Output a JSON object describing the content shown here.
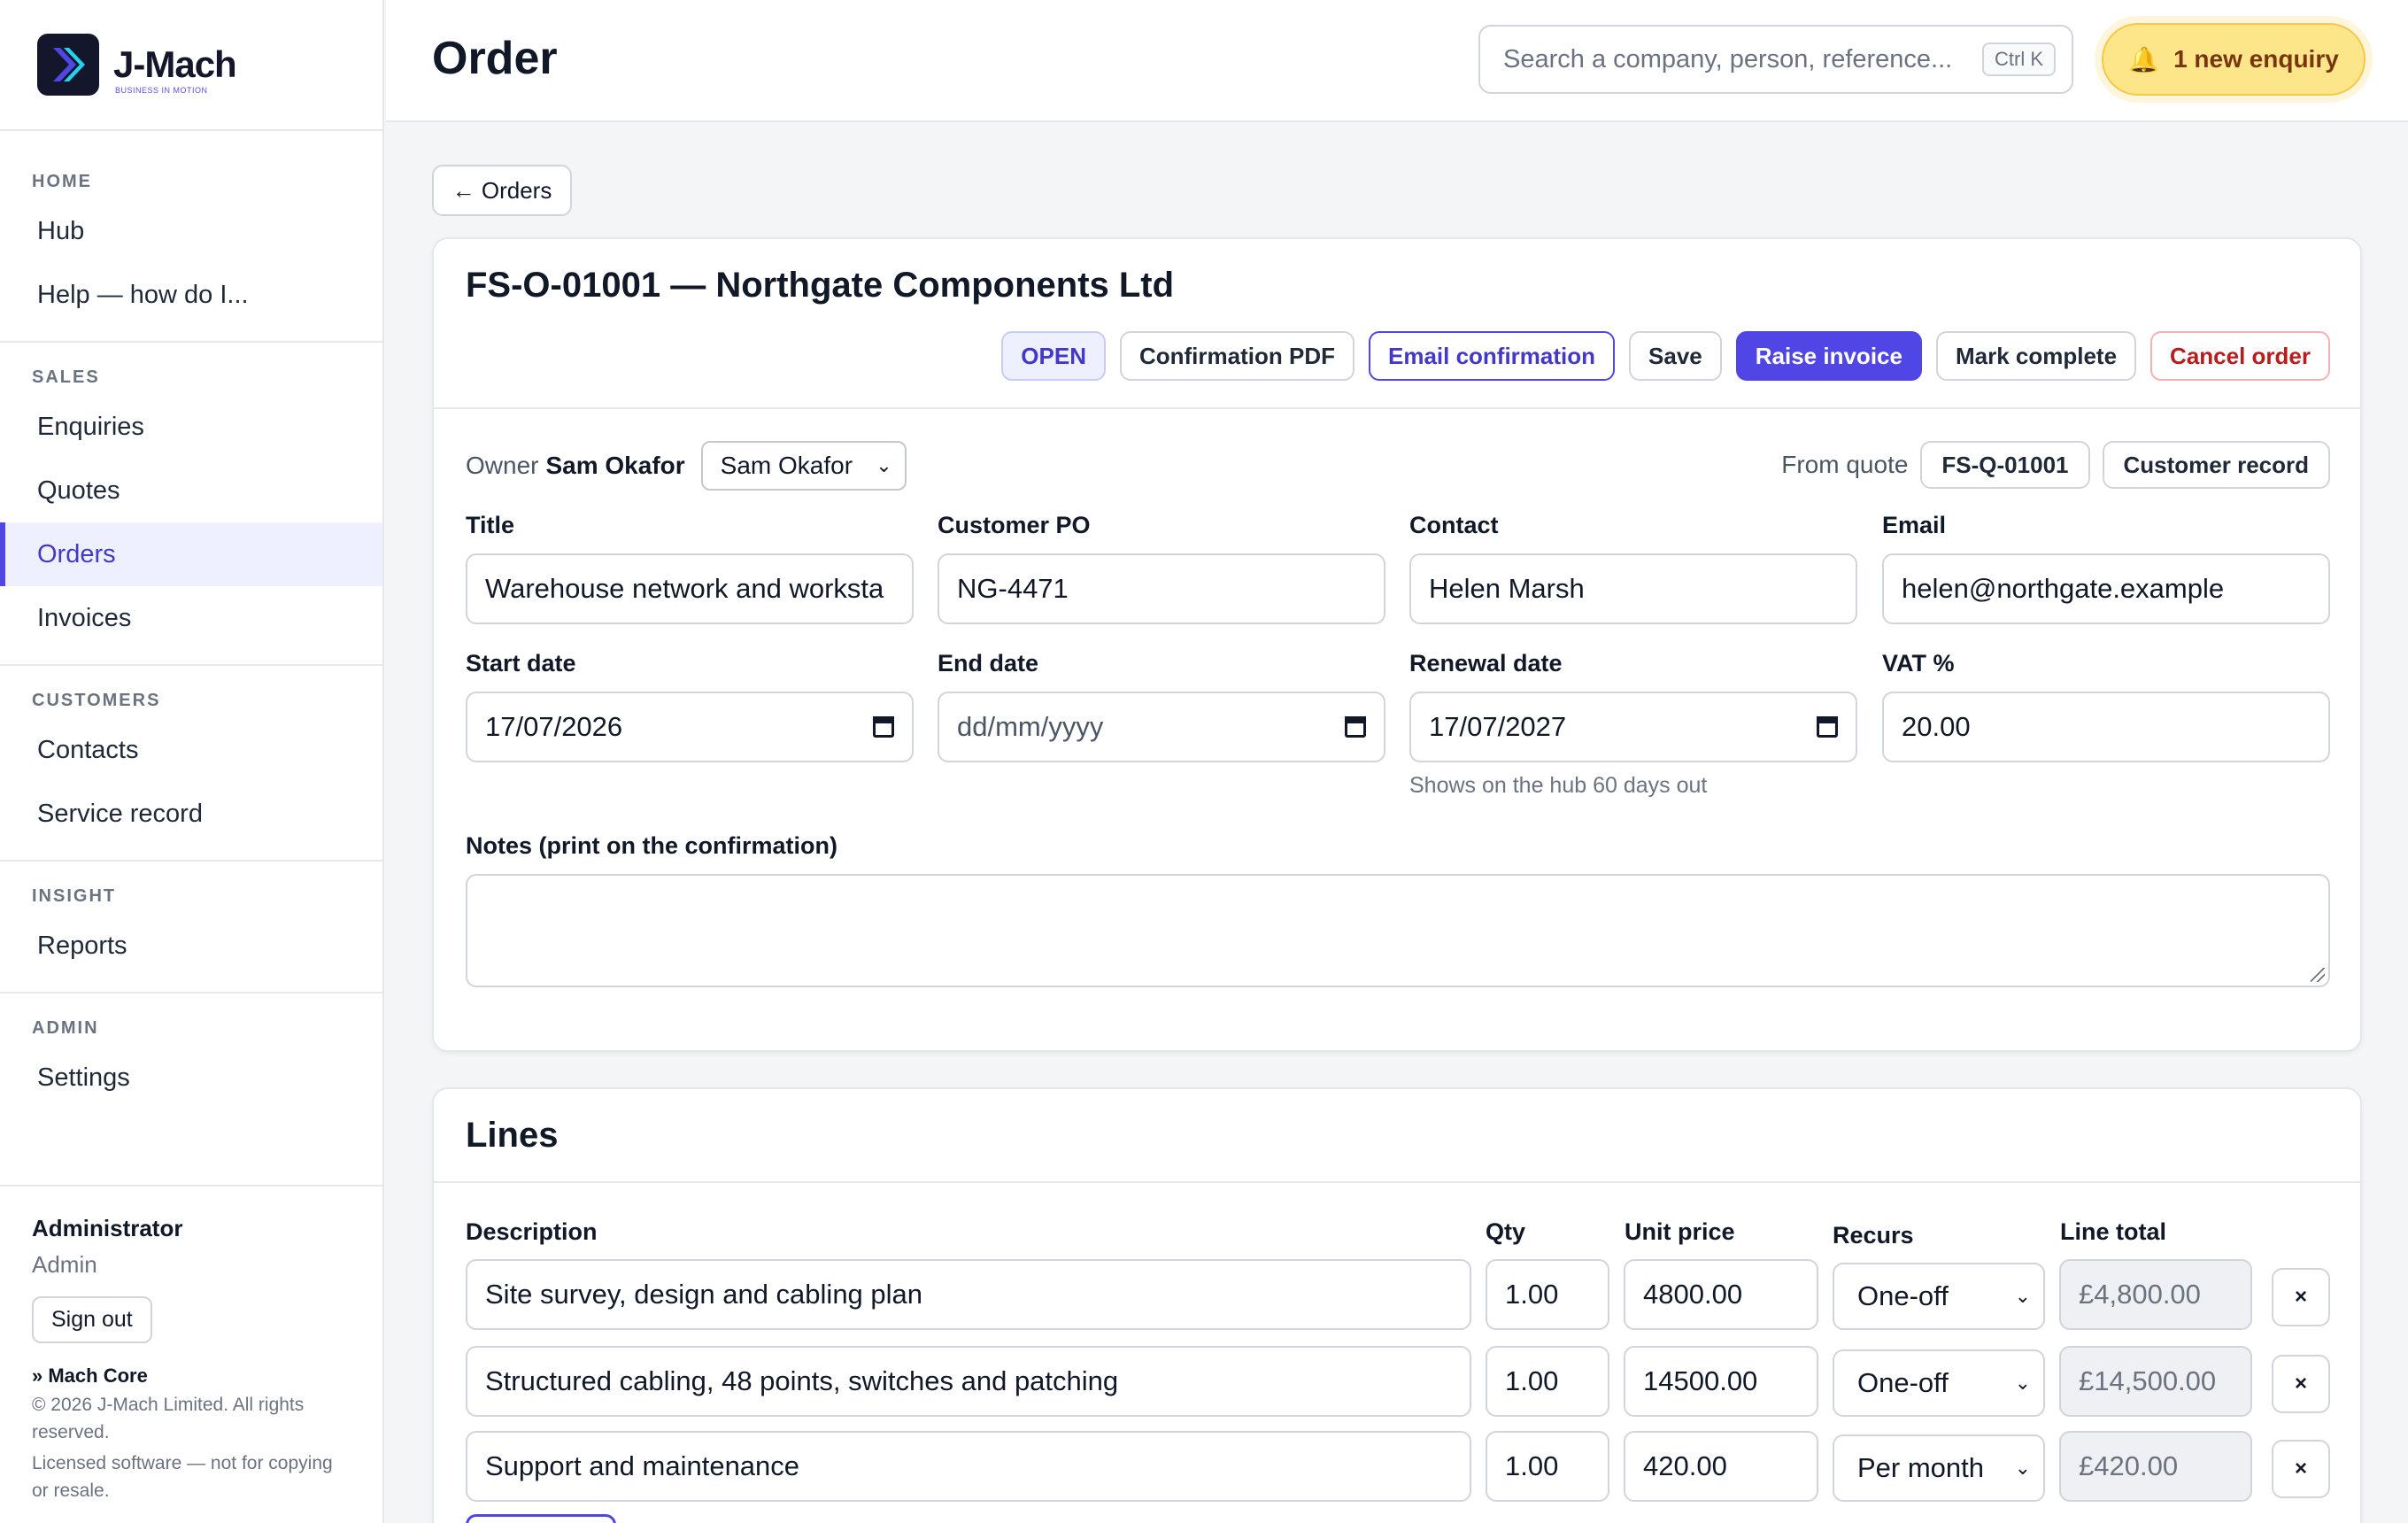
{
  "brand": {
    "name": "J-Mach",
    "tagline": "BUSINESS IN MOTION",
    "accent": "#4f46e5"
  },
  "sidebar": {
    "sections": [
      {
        "heading": "HOME",
        "items": [
          "Hub",
          "Help — how do I..."
        ]
      },
      {
        "heading": "SALES",
        "items": [
          "Enquiries",
          "Quotes",
          "Orders",
          "Invoices"
        ]
      },
      {
        "heading": "CUSTOMERS",
        "items": [
          "Contacts",
          "Service record"
        ]
      },
      {
        "heading": "INSIGHT",
        "items": [
          "Reports"
        ]
      },
      {
        "heading": "ADMIN",
        "items": [
          "Settings"
        ]
      }
    ],
    "active_item": "Orders",
    "footer": {
      "user_name": "Administrator",
      "user_role": "Admin",
      "signout_label": "Sign out",
      "product": "» Mach Core",
      "copyright": "© 2026 J-Mach Limited. All rights reserved.",
      "license": "Licensed software — not for copying or resale."
    }
  },
  "header": {
    "title": "Order",
    "search_placeholder": "Search a company, person, reference...",
    "search_shortcut": "Ctrl K",
    "enquiry_label": "1 new enquiry",
    "enquiry_icon": "bell-icon"
  },
  "back_label": "← Orders",
  "order": {
    "title": "FS-O-01001 — Northgate Components Ltd",
    "status": "OPEN",
    "actions": {
      "confirmation_pdf": "Confirmation PDF",
      "email_confirmation": "Email confirmation",
      "save": "Save",
      "raise_invoice": "Raise invoice",
      "mark_complete": "Mark complete",
      "cancel_order": "Cancel order"
    },
    "owner_label": "Owner",
    "owner_name": "Sam Okafor",
    "owner_select": "Sam Okafor",
    "from_quote_label": "From quote",
    "quote_ref": "FS-Q-01001",
    "customer_record_label": "Customer record",
    "fields": {
      "title_label": "Title",
      "title_value": "Warehouse network and worksta",
      "po_label": "Customer PO",
      "po_value": "NG-4471",
      "contact_label": "Contact",
      "contact_value": "Helen Marsh",
      "email_label": "Email",
      "email_value": "helen@northgate.example",
      "start_label": "Start date",
      "start_value": "17/07/2026",
      "end_label": "End date",
      "end_value": "dd/mm/yyyy",
      "renewal_label": "Renewal date",
      "renewal_value": "17/07/2027",
      "renewal_hint": "Shows on the hub 60 days out",
      "vat_label": "VAT %",
      "vat_value": "20.00",
      "notes_label": "Notes (print on the confirmation)",
      "notes_value": ""
    }
  },
  "lines": {
    "title": "Lines",
    "columns": [
      "Description",
      "Qty",
      "Unit price",
      "Recurs",
      "Line total"
    ],
    "rows": [
      {
        "description": "Site survey, design and cabling plan",
        "qty": "1.00",
        "unit_price": "4800.00",
        "recurs": "One-off",
        "total": "£4,800.00"
      },
      {
        "description": "Structured cabling, 48 points, switches and patching",
        "qty": "1.00",
        "unit_price": "14500.00",
        "recurs": "One-off",
        "total": "£14,500.00"
      },
      {
        "description": "Support and maintenance",
        "qty": "1.00",
        "unit_price": "420.00",
        "recurs": "Per month",
        "total": "£420.00"
      }
    ],
    "remove_label": "×"
  }
}
